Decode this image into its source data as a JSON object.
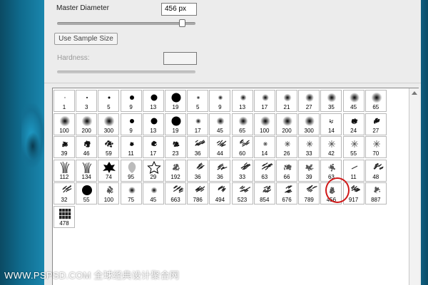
{
  "brush_options": {
    "master_diameter_label": "Master Diameter",
    "master_diameter_value": "456 px",
    "master_diameter_slider_level": 0.9,
    "use_sample_size_label": "Use Sample Size",
    "hardness_label": "Hardness:",
    "hardness_value": ""
  },
  "presets": {
    "rows": [
      [
        {
          "n": "1",
          "t": "hard",
          "s": 1
        },
        {
          "n": "3",
          "t": "hard",
          "s": 2
        },
        {
          "n": "5",
          "t": "hard",
          "s": 3
        },
        {
          "n": "9",
          "t": "hard",
          "s": 6
        },
        {
          "n": "13",
          "t": "hard",
          "s": 9
        },
        {
          "n": "19",
          "t": "hard",
          "s": 13
        },
        {
          "n": "5",
          "t": "soft",
          "s": 3
        },
        {
          "n": "9",
          "t": "soft",
          "s": 5
        },
        {
          "n": "13",
          "t": "soft",
          "s": 7
        },
        {
          "n": "17",
          "t": "soft",
          "s": 8
        },
        {
          "n": "21",
          "t": "soft",
          "s": 9
        },
        {
          "n": "27",
          "t": "soft",
          "s": 10
        },
        {
          "n": "35",
          "t": "soft",
          "s": 11
        },
        {
          "n": "45",
          "t": "soft",
          "s": 12
        },
        {
          "n": "65",
          "t": "soft",
          "s": 13
        }
      ],
      [
        {
          "n": "100",
          "t": "soft",
          "s": 13
        },
        {
          "n": "200",
          "t": "soft",
          "s": 13
        },
        {
          "n": "300",
          "t": "soft",
          "s": 13
        },
        {
          "n": "9",
          "t": "hard",
          "s": 6
        },
        {
          "n": "13",
          "t": "hard",
          "s": 9
        },
        {
          "n": "19",
          "t": "hard",
          "s": 13
        },
        {
          "n": "17",
          "t": "soft",
          "s": 6
        },
        {
          "n": "45",
          "t": "soft",
          "s": 9
        },
        {
          "n": "65",
          "t": "soft",
          "s": 11
        },
        {
          "n": "100",
          "t": "soft",
          "s": 12
        },
        {
          "n": "200",
          "t": "soft",
          "s": 12
        },
        {
          "n": "300",
          "t": "soft",
          "s": 12
        },
        {
          "n": "14",
          "t": "speck",
          "s": 6
        },
        {
          "n": "24",
          "t": "splat",
          "s": 8
        },
        {
          "n": "27",
          "t": "splat",
          "s": 8
        }
      ],
      [
        {
          "n": "39",
          "t": "splat",
          "s": 9
        },
        {
          "n": "46",
          "t": "splat",
          "s": 9
        },
        {
          "n": "59",
          "t": "splat",
          "s": 10
        },
        {
          "n": "11",
          "t": "splat",
          "s": 5
        },
        {
          "n": "17",
          "t": "splat",
          "s": 7
        },
        {
          "n": "23",
          "t": "splat",
          "s": 8
        },
        {
          "n": "36",
          "t": "streak",
          "s": 10
        },
        {
          "n": "44",
          "t": "streak",
          "s": 10
        },
        {
          "n": "60",
          "t": "streak",
          "s": 10
        },
        {
          "n": "14",
          "t": "star",
          "s": 6
        },
        {
          "n": "26",
          "t": "star",
          "s": 8
        },
        {
          "n": "33",
          "t": "star",
          "s": 9
        },
        {
          "n": "42",
          "t": "star",
          "s": 10
        },
        {
          "n": "55",
          "t": "star",
          "s": 10
        },
        {
          "n": "70",
          "t": "star",
          "s": 10
        }
      ],
      [
        {
          "n": "112",
          "t": "grass",
          "s": 10
        },
        {
          "n": "134",
          "t": "grass",
          "s": 10
        },
        {
          "n": "74",
          "t": "leaf",
          "s": 9
        },
        {
          "n": "95",
          "t": "leafsoft",
          "s": 9
        },
        {
          "n": "29",
          "t": "staroutline",
          "s": 9
        },
        {
          "n": "192",
          "t": "texture",
          "s": 10
        },
        {
          "n": "36",
          "t": "streak",
          "s": 10
        },
        {
          "n": "36",
          "t": "streak",
          "s": 10
        },
        {
          "n": "33",
          "t": "streak",
          "s": 10
        },
        {
          "n": "63",
          "t": "streak",
          "s": 10
        },
        {
          "n": "66",
          "t": "texture",
          "s": 10
        },
        {
          "n": "39",
          "t": "texture",
          "s": 10
        },
        {
          "n": "63",
          "t": "texture",
          "s": 10
        },
        {
          "n": "11",
          "t": "line",
          "s": 6
        },
        {
          "n": "48",
          "t": "streak",
          "s": 10
        }
      ],
      [
        {
          "n": "32",
          "t": "streak",
          "s": 10
        },
        {
          "n": "55",
          "t": "hard",
          "s": 14
        },
        {
          "n": "100",
          "t": "texture",
          "s": 11
        },
        {
          "n": "75",
          "t": "soft",
          "s": 8
        },
        {
          "n": "45",
          "t": "soft",
          "s": 7
        },
        {
          "n": "663",
          "t": "streak",
          "s": 10
        },
        {
          "n": "786",
          "t": "streak",
          "s": 10
        },
        {
          "n": "494",
          "t": "streak",
          "s": 10
        },
        {
          "n": "523",
          "t": "streak",
          "s": 10
        },
        {
          "n": "854",
          "t": "streak",
          "s": 10
        },
        {
          "n": "676",
          "t": "streak",
          "s": 10
        },
        {
          "n": "789",
          "t": "streak",
          "s": 10
        },
        {
          "n": "456",
          "t": "texture",
          "s": 9
        },
        {
          "n": "917",
          "t": "streak",
          "s": 10
        },
        {
          "n": "887",
          "t": "texture",
          "s": 10
        }
      ],
      [
        {
          "n": "478",
          "t": "blocks",
          "s": 11
        }
      ]
    ],
    "selected": "456"
  },
  "watermark": {
    "text": "WWW.PSPSD.COM 全球经典设计聚合网"
  }
}
